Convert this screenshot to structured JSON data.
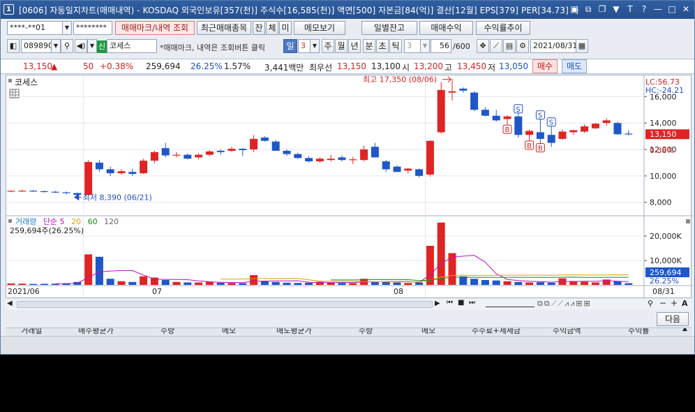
{
  "window": {
    "number": "1",
    "title": "[0606] 자동일지차트(매매내역) - KOSDAQ 외국인보유[357(천)] 주식수[16,585(천)] 액면[500] 자본금[84(억)] 결산[12월] EPS[379] PER[34.73] 사"
  },
  "account": {
    "number": "****-**01",
    "password": "********"
  },
  "toolbar1": {
    "mark_query": "매매마크/내역 조회",
    "recent_items": "최근매매종목",
    "jan": "잔",
    "che": "체",
    "mi": "미",
    "memo_view": "메모보기",
    "daily_balance": "일별잔고",
    "trade_profit": "매매수익",
    "profit_trend": "수익률추이"
  },
  "toolbar2": {
    "code": "089890",
    "credit_badge": "신",
    "stock_name": "코세스",
    "hint": "*매매마크, 내역은 조회버튼 클릭",
    "periods": [
      "일",
      "3",
      "주",
      "월",
      "년",
      "분",
      "초",
      "틱"
    ],
    "tick_value": "3",
    "count": "56",
    "count_total": "/600",
    "date": "2021/08/31"
  },
  "quote": {
    "price": "13,150",
    "arrow": "▲",
    "change": "50",
    "change_pct": "+0.38%",
    "volume": "259,694",
    "vol_ratio": "26.25%",
    "turnover": "1.57%",
    "amount": "3,441백만",
    "best_label": "최우선",
    "best_ask": "13,150",
    "best_bid": "13,100",
    "open_label": "시",
    "open": "13,200",
    "high_label": "고",
    "high": "13,450",
    "low_label": "저",
    "low": "13,050",
    "buy_button": "매수",
    "sell_button": "매도"
  },
  "chart_data": {
    "type": "candlestick",
    "stock": "코세스",
    "price_axis": {
      "ticks": [
        "16,000",
        "14,000",
        "12,000",
        "10,000",
        "8,000"
      ],
      "min": 7300,
      "max": 17600
    },
    "volume_axis": {
      "ticks": [
        "20,000K",
        "10,000K"
      ],
      "max": 26000
    },
    "lc_label": "LC:56.73",
    "hc_label": "HC:-24.21",
    "price_tag": "13,150",
    "price_pct": "0.38%",
    "volume_tag": "259,694",
    "volume_pct": "26.25%",
    "high_note": "최고 17,350 (08/06)",
    "low_note": "최저 8,390 (06/21)",
    "volume_title": "거래량",
    "ma_legend": [
      "단순 5",
      "20",
      "60",
      "120"
    ],
    "volume_readout": "259,694주(26.25%)",
    "x_labels": [
      "2021/06",
      "07",
      "08",
      "08/31"
    ],
    "candles": [
      [
        8820,
        8900,
        8760,
        8870,
        600
      ],
      [
        8870,
        8950,
        8800,
        8880,
        500
      ],
      [
        8880,
        8930,
        8800,
        8840,
        400
      ],
      [
        8840,
        8900,
        8750,
        8800,
        450
      ],
      [
        8800,
        8880,
        8700,
        8760,
        500
      ],
      [
        8760,
        8820,
        8600,
        8700,
        700
      ],
      [
        8700,
        8750,
        8390,
        8560,
        1200
      ],
      [
        8560,
        11200,
        8500,
        11050,
        12500
      ],
      [
        11000,
        11200,
        10300,
        10500,
        11500
      ],
      [
        10500,
        10700,
        10000,
        10200,
        2500
      ],
      [
        10200,
        10500,
        10100,
        10350,
        1500
      ],
      [
        10300,
        10550,
        10000,
        10150,
        1200
      ],
      [
        10200,
        11300,
        10150,
        11150,
        3500
      ],
      [
        11150,
        11900,
        10950,
        11800,
        3000
      ],
      [
        12100,
        12500,
        11400,
        11550,
        2000
      ],
      [
        11550,
        11800,
        11400,
        11600,
        1200
      ],
      [
        11600,
        11700,
        11250,
        11300,
        1000
      ],
      [
        11400,
        11700,
        11250,
        11600,
        1000
      ],
      [
        11600,
        11950,
        11500,
        11850,
        1300
      ],
      [
        11900,
        12000,
        11600,
        11800,
        900
      ],
      [
        11900,
        12200,
        11800,
        12050,
        800
      ],
      [
        12050,
        12100,
        11500,
        11950,
        700
      ],
      [
        12000,
        13100,
        11800,
        12800,
        4000
      ],
      [
        12900,
        13000,
        12600,
        12650,
        1500
      ],
      [
        12600,
        12700,
        11900,
        11900,
        1200
      ],
      [
        11900,
        12000,
        11500,
        11650,
        900
      ],
      [
        11650,
        11750,
        11300,
        11350,
        800
      ],
      [
        11350,
        11500,
        11000,
        11100,
        900
      ],
      [
        11100,
        11400,
        11000,
        11300,
        1300
      ],
      [
        11200,
        11600,
        11100,
        11300,
        1000
      ],
      [
        11400,
        11550,
        11100,
        11200,
        800
      ],
      [
        11200,
        11450,
        10900,
        11250,
        700
      ],
      [
        11200,
        12300,
        11100,
        12000,
        2500
      ],
      [
        12200,
        12500,
        11400,
        11400,
        1300
      ],
      [
        11100,
        11200,
        10300,
        10500,
        1300
      ],
      [
        10700,
        10800,
        10300,
        10300,
        1000
      ],
      [
        10400,
        10600,
        10200,
        10550,
        800
      ],
      [
        10500,
        10550,
        9900,
        10000,
        1000
      ],
      [
        10100,
        12700,
        9950,
        12650,
        16000
      ],
      [
        13300,
        17100,
        13200,
        16500,
        25500
      ],
      [
        16300,
        17350,
        15700,
        16400,
        13000
      ],
      [
        16600,
        16700,
        16300,
        16450,
        3500
      ],
      [
        16300,
        16400,
        14900,
        15000,
        2500
      ],
      [
        15000,
        15200,
        14500,
        14550,
        2000
      ],
      [
        14550,
        15000,
        14100,
        14200,
        1800
      ],
      [
        14300,
        14600,
        14000,
        14500,
        1500
      ],
      [
        14500,
        14600,
        12900,
        13100,
        1200
      ],
      [
        13100,
        13500,
        12800,
        13400,
        1000
      ],
      [
        13300,
        13500,
        12600,
        12800,
        1100
      ],
      [
        13100,
        13600,
        12200,
        12500,
        900
      ],
      [
        12800,
        13500,
        12750,
        13350,
        2700
      ],
      [
        13300,
        13500,
        13100,
        13450,
        1500
      ],
      [
        13350,
        13900,
        13250,
        13750,
        1300
      ],
      [
        13600,
        14000,
        13550,
        13950,
        1000
      ],
      [
        14000,
        14350,
        13800,
        14200,
        2200
      ],
      [
        14000,
        14100,
        13100,
        13150,
        1500
      ],
      [
        13200,
        13450,
        13050,
        13150,
        700
      ]
    ],
    "trade_marks": [
      {
        "type": "B",
        "index": 45
      },
      {
        "type": "S",
        "index": 46
      },
      {
        "type": "B",
        "index": 47
      },
      {
        "type": "S",
        "index": 48
      },
      {
        "type": "B",
        "index": 48
      },
      {
        "type": "S",
        "index": 49
      }
    ]
  },
  "navbar": {
    "left_arrow": "◀",
    "right_arrow": "▶",
    "zoom_minus": "−",
    "zoom_plus": "+",
    "font_a": "A"
  },
  "bottom": {
    "next_button": "다음",
    "columns": [
      "거래일",
      "매수평균가",
      "수량",
      "메모",
      "매도평균가",
      "수량",
      "메모",
      "수수료+제세금",
      "수익금액",
      "수익률"
    ]
  },
  "colors": {
    "up": "#e02424",
    "down": "#1f57c9",
    "accent": "#2f5fa3"
  }
}
